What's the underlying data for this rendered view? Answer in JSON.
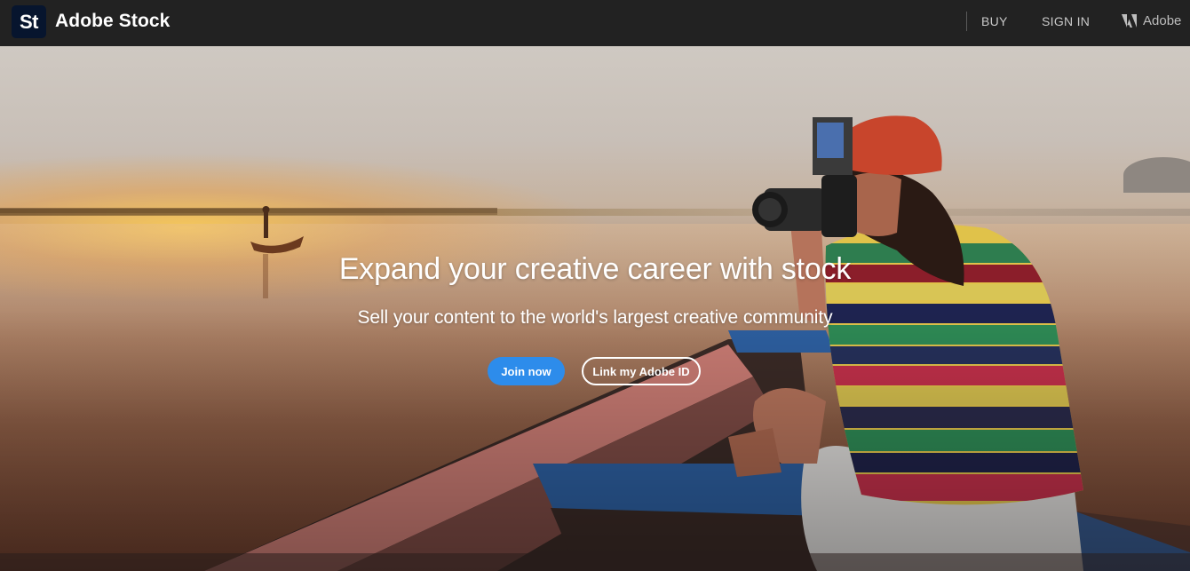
{
  "header": {
    "logo_text": "St",
    "brand": "Adobe Stock",
    "nav": {
      "buy": "BUY",
      "sign_in": "SIGN IN",
      "adobe": "Adobe"
    },
    "colors": {
      "bar": "#222222",
      "logo_tile": "#07152e"
    }
  },
  "hero": {
    "headline": "Expand your creative career with stock",
    "subhead": "Sell your content to the world's largest creative community",
    "buttons": {
      "join": "Join now",
      "link_id": "Link my Adobe ID"
    },
    "colors": {
      "join_button": "#2d8ceb"
    }
  },
  "icons": {
    "adobe_logo": "adobe-logo-icon"
  }
}
